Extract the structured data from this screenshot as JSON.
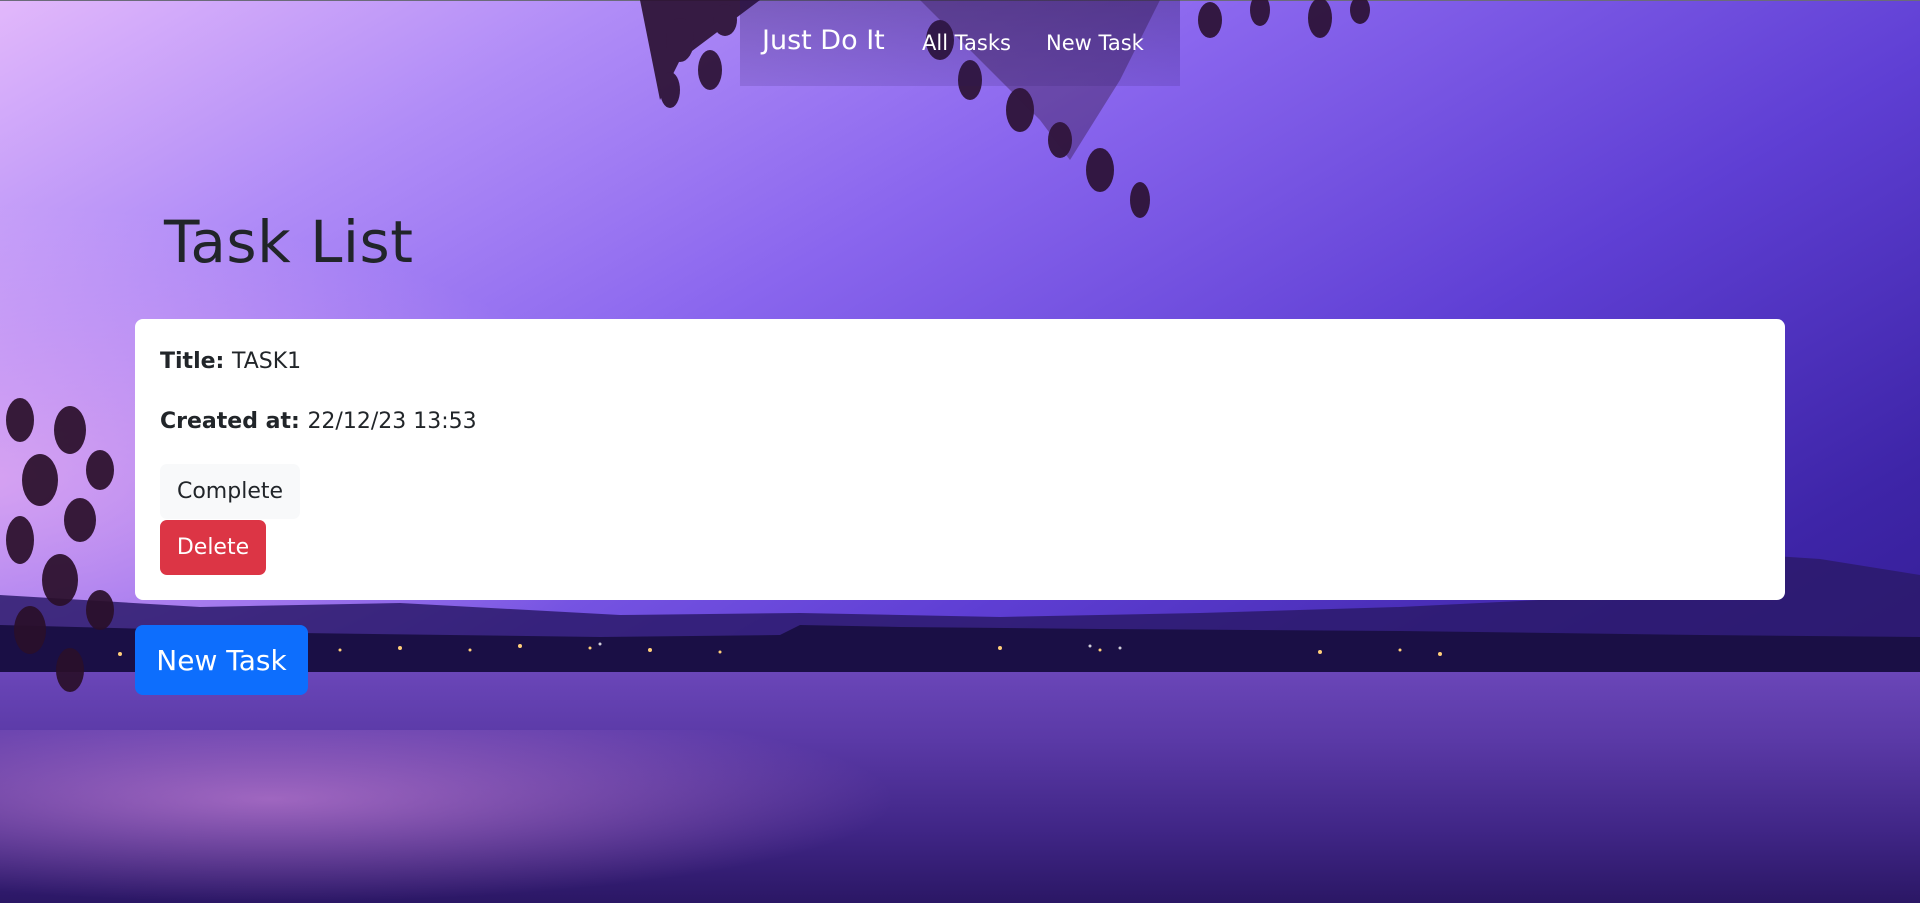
{
  "nav": {
    "brand": "Just Do It",
    "links": [
      {
        "label": "All Tasks"
      },
      {
        "label": "New Task"
      }
    ]
  },
  "page": {
    "title": "Task List"
  },
  "tasks": [
    {
      "title_label": "Title:",
      "title_value": "TASK1",
      "created_label": "Created at:",
      "created_value": "22/12/23 13:53",
      "complete_label": "Complete",
      "delete_label": "Delete"
    }
  ],
  "actions": {
    "new_task_label": "New Task"
  },
  "colors": {
    "primary": "#0d6efd",
    "danger": "#dc3545",
    "light": "#f8f9fa",
    "text": "#212529"
  }
}
